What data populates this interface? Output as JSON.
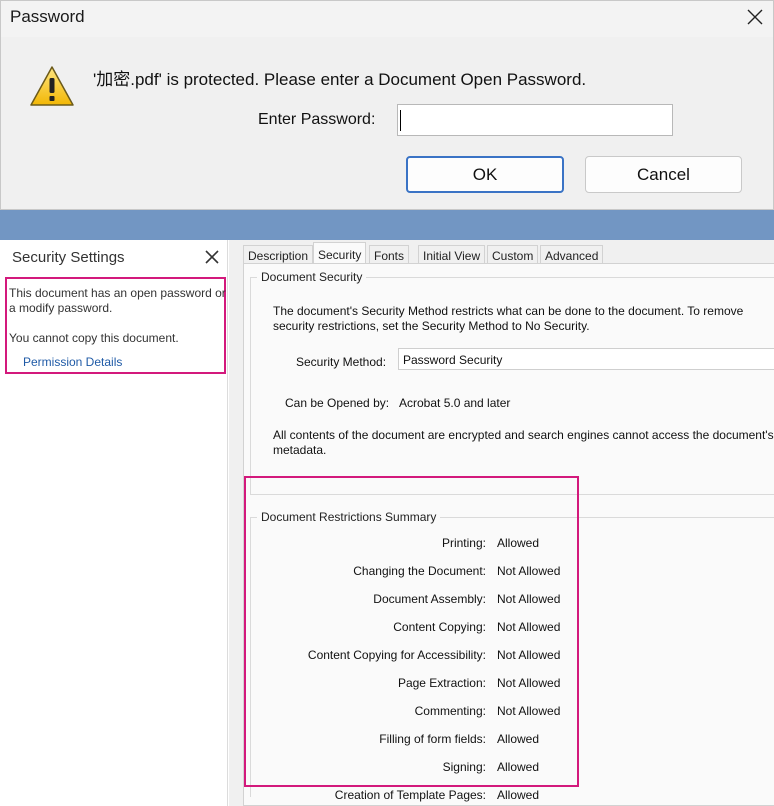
{
  "password_dialog": {
    "title": "Password",
    "message": "'加密.pdf' is protected. Please enter a Document Open Password.",
    "password_label": "Enter Password:",
    "password_value": "",
    "ok_label": "OK",
    "cancel_label": "Cancel",
    "icons": {
      "close": "close-icon",
      "warning": "warning-icon"
    }
  },
  "security_settings": {
    "title": "Security Settings",
    "open_password_text": "This document has an open password or a modify password.",
    "no_copy_text": "You cannot copy this document.",
    "permission_link": "Permission Details"
  },
  "properties": {
    "tabs": [
      "Description",
      "Security",
      "Fonts",
      "Initial View",
      "Custom",
      "Advanced"
    ],
    "active_tab": "Security",
    "document_security": {
      "legend": "Document Security",
      "description": "The document's Security Method restricts what can be done to the document. To remove security restrictions, set the Security Method to No Security.",
      "security_method_label": "Security Method:",
      "security_method_value": "Password Security",
      "can_be_opened_label": "Can be Opened by:",
      "can_be_opened_value": "Acrobat 5.0 and later",
      "encryption_note": "All contents of the document are encrypted and search engines cannot access the document's metadata."
    },
    "restrictions": {
      "legend": "Document Restrictions Summary",
      "rows": [
        {
          "label": "Printing:",
          "value": "Allowed"
        },
        {
          "label": "Changing the Document:",
          "value": "Not Allowed"
        },
        {
          "label": "Document Assembly:",
          "value": "Not Allowed"
        },
        {
          "label": "Content Copying:",
          "value": "Not Allowed"
        },
        {
          "label": "Content Copying for Accessibility:",
          "value": "Not Allowed"
        },
        {
          "label": "Page Extraction:",
          "value": "Not Allowed"
        },
        {
          "label": "Commenting:",
          "value": "Not Allowed"
        },
        {
          "label": "Filling of form fields:",
          "value": "Allowed"
        },
        {
          "label": "Signing:",
          "value": "Allowed"
        },
        {
          "label": "Creation of Template Pages:",
          "value": "Allowed"
        }
      ]
    }
  },
  "colors": {
    "highlight": "#d3197c",
    "band": "#7296c3",
    "link": "#1f5aa6",
    "ok_border": "#3a73c5"
  }
}
